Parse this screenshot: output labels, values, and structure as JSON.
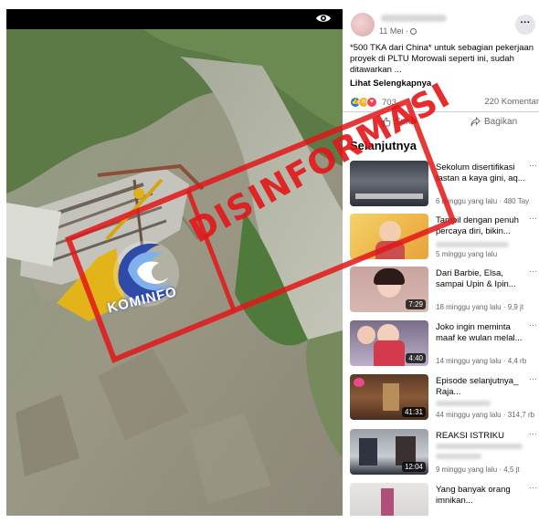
{
  "video": {
    "background_color": "#0b0b0b"
  },
  "post": {
    "time": "11 Mei ·",
    "text": "*500 TKA dari China* untuk sebagian pekerjaan proyek di PLTU Morowali seperti ini, sudah ditawarkan ...",
    "see_more": "Lihat Selengkapnya",
    "reaction_count": "703",
    "comment_count": "220 Komentar",
    "like_label": "Suka",
    "share_label": "Bagikan"
  },
  "next_heading": "Selanjutnya",
  "suggestions": [
    {
      "title": "Sekolum disertifikasi tastan a kaya gini, aq...",
      "meta": "6 minggu yang lalu · 480 Tay",
      "duration": ""
    },
    {
      "title": "Tampil dengan penuh percaya diri, bikin...",
      "meta": "5 minggu yang lalu",
      "duration": ""
    },
    {
      "title": "Dari Barbie, Elsa, sampai Upin & Ipin...",
      "meta": "18 minggu yang lalu · 9,9 jt",
      "duration": "7:29"
    },
    {
      "title": "Joko ingin meminta maaf ke wulan melal...",
      "meta": "14 minggu yang lalu · 4,4 rb",
      "duration": "4:40"
    },
    {
      "title": "Episode selanjutnya_ Raja...",
      "meta": "44 minggu yang lalu · 314,7 rb",
      "duration": "41:31"
    },
    {
      "title": "REAKSI ISTRIKU",
      "meta": "9 minggu yang lalu · 4,5 jt",
      "duration": "12:04"
    },
    {
      "title": "Yang banyak orang imnikan...",
      "meta": "",
      "duration": ""
    }
  ],
  "stamp": {
    "text": "DISINFORMASI",
    "logo_text": "KOMINFO",
    "color": "#e21618"
  },
  "colors": {
    "accent": "#1877f2",
    "text": "#050505",
    "muted": "#65676b"
  }
}
